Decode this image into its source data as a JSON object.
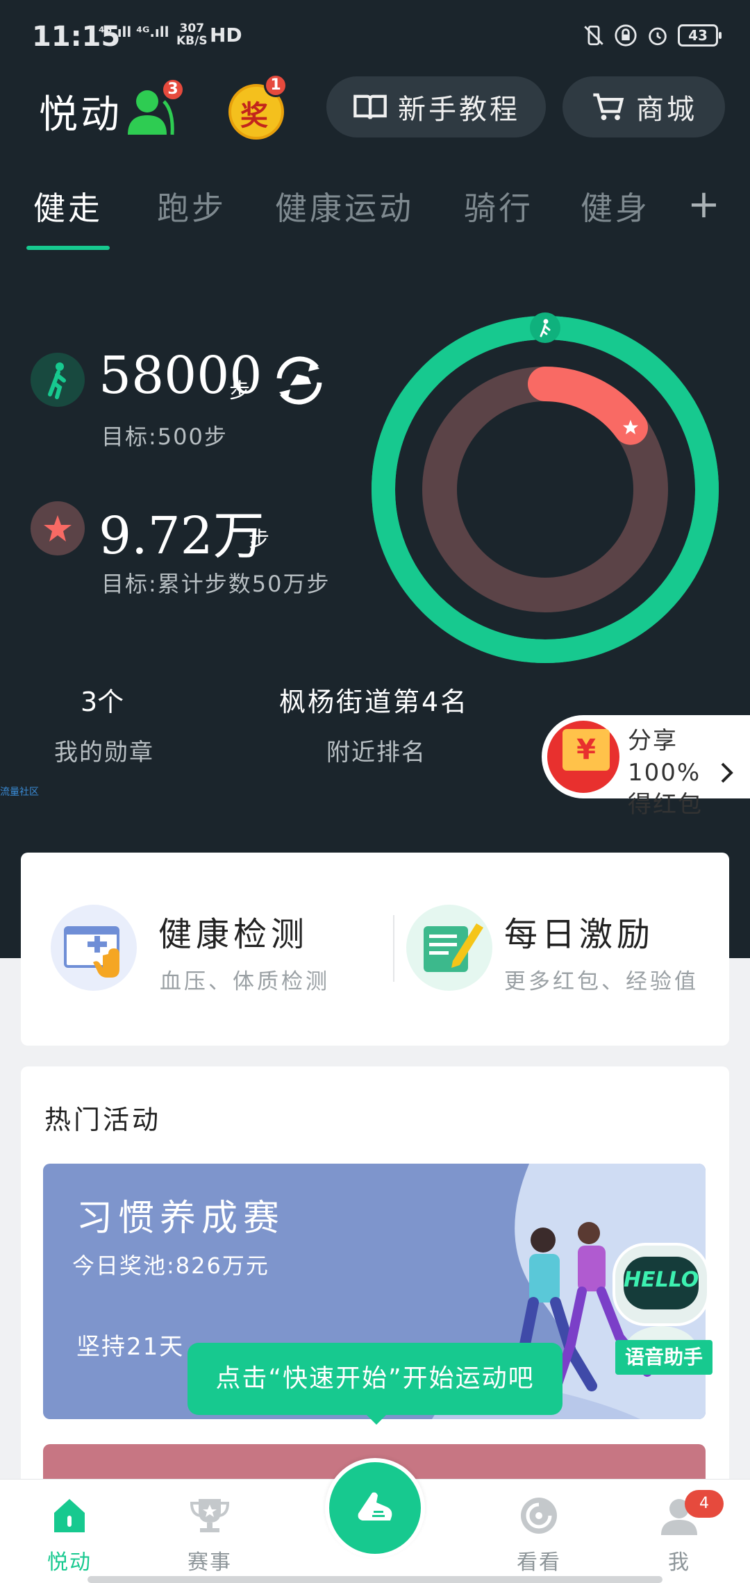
{
  "status_bar": {
    "time": "11:15",
    "network": "⁴ᴳ.ıll ⁴ᴳ.ıll",
    "speed_value": "307",
    "speed_unit": "KB/S",
    "hd": "HD",
    "battery": "43"
  },
  "header": {
    "title": "悦动",
    "friends_badge": "3",
    "prize_label": "奖",
    "prize_badge": "1",
    "tutorial_label": "新手教程",
    "shop_label": "商城"
  },
  "tabs": [
    {
      "label": "健走",
      "active": true
    },
    {
      "label": "跑步",
      "active": false
    },
    {
      "label": "健康运动",
      "active": false
    },
    {
      "label": "骑行",
      "active": false
    },
    {
      "label": "健身",
      "active": false
    }
  ],
  "tab_add": "+",
  "stats": {
    "steps_value": "58000",
    "steps_unit": "步",
    "steps_goal": "目标:500步",
    "total_value": "9.72万",
    "total_unit": "步",
    "total_goal": "目标:累计步数50万步",
    "outer_ring_progress": 1.0,
    "inner_ring_progress": 0.15
  },
  "summary": {
    "medals_value": "3个",
    "medals_label": "我的勋章",
    "rank_value": "枫杨街道第4名",
    "rank_label": "附近排名",
    "community_link": "流量社区"
  },
  "red_packet": {
    "line1": "分享100%",
    "line2": "得红包",
    "symbol": "¥"
  },
  "features": [
    {
      "title": "健康检测",
      "subtitle": "血压、体质检测"
    },
    {
      "title": "每日激励",
      "subtitle": "更多红包、经验值"
    }
  ],
  "hot_section": {
    "title": "热门活动",
    "banner_title": "习惯养成赛",
    "banner_pool": "今日奖池:826万元",
    "banner_desc": "坚持21天"
  },
  "tooltip": "点击“快速开始”开始运动吧",
  "assistant": {
    "screen_text": "HELLO",
    "label": "语音助手"
  },
  "bottom_nav": [
    {
      "label": "悦动",
      "active": true
    },
    {
      "label": "赛事",
      "active": false
    },
    {
      "label": "看看",
      "active": false
    },
    {
      "label": "我",
      "active": false,
      "badge": "4"
    }
  ],
  "colors": {
    "accent": "#17c98f",
    "background_dark": "#1b252c",
    "ring_inner_track": "#5b4347",
    "ring_inner_fill": "#f96a64",
    "badge_red": "#e64a3d"
  }
}
